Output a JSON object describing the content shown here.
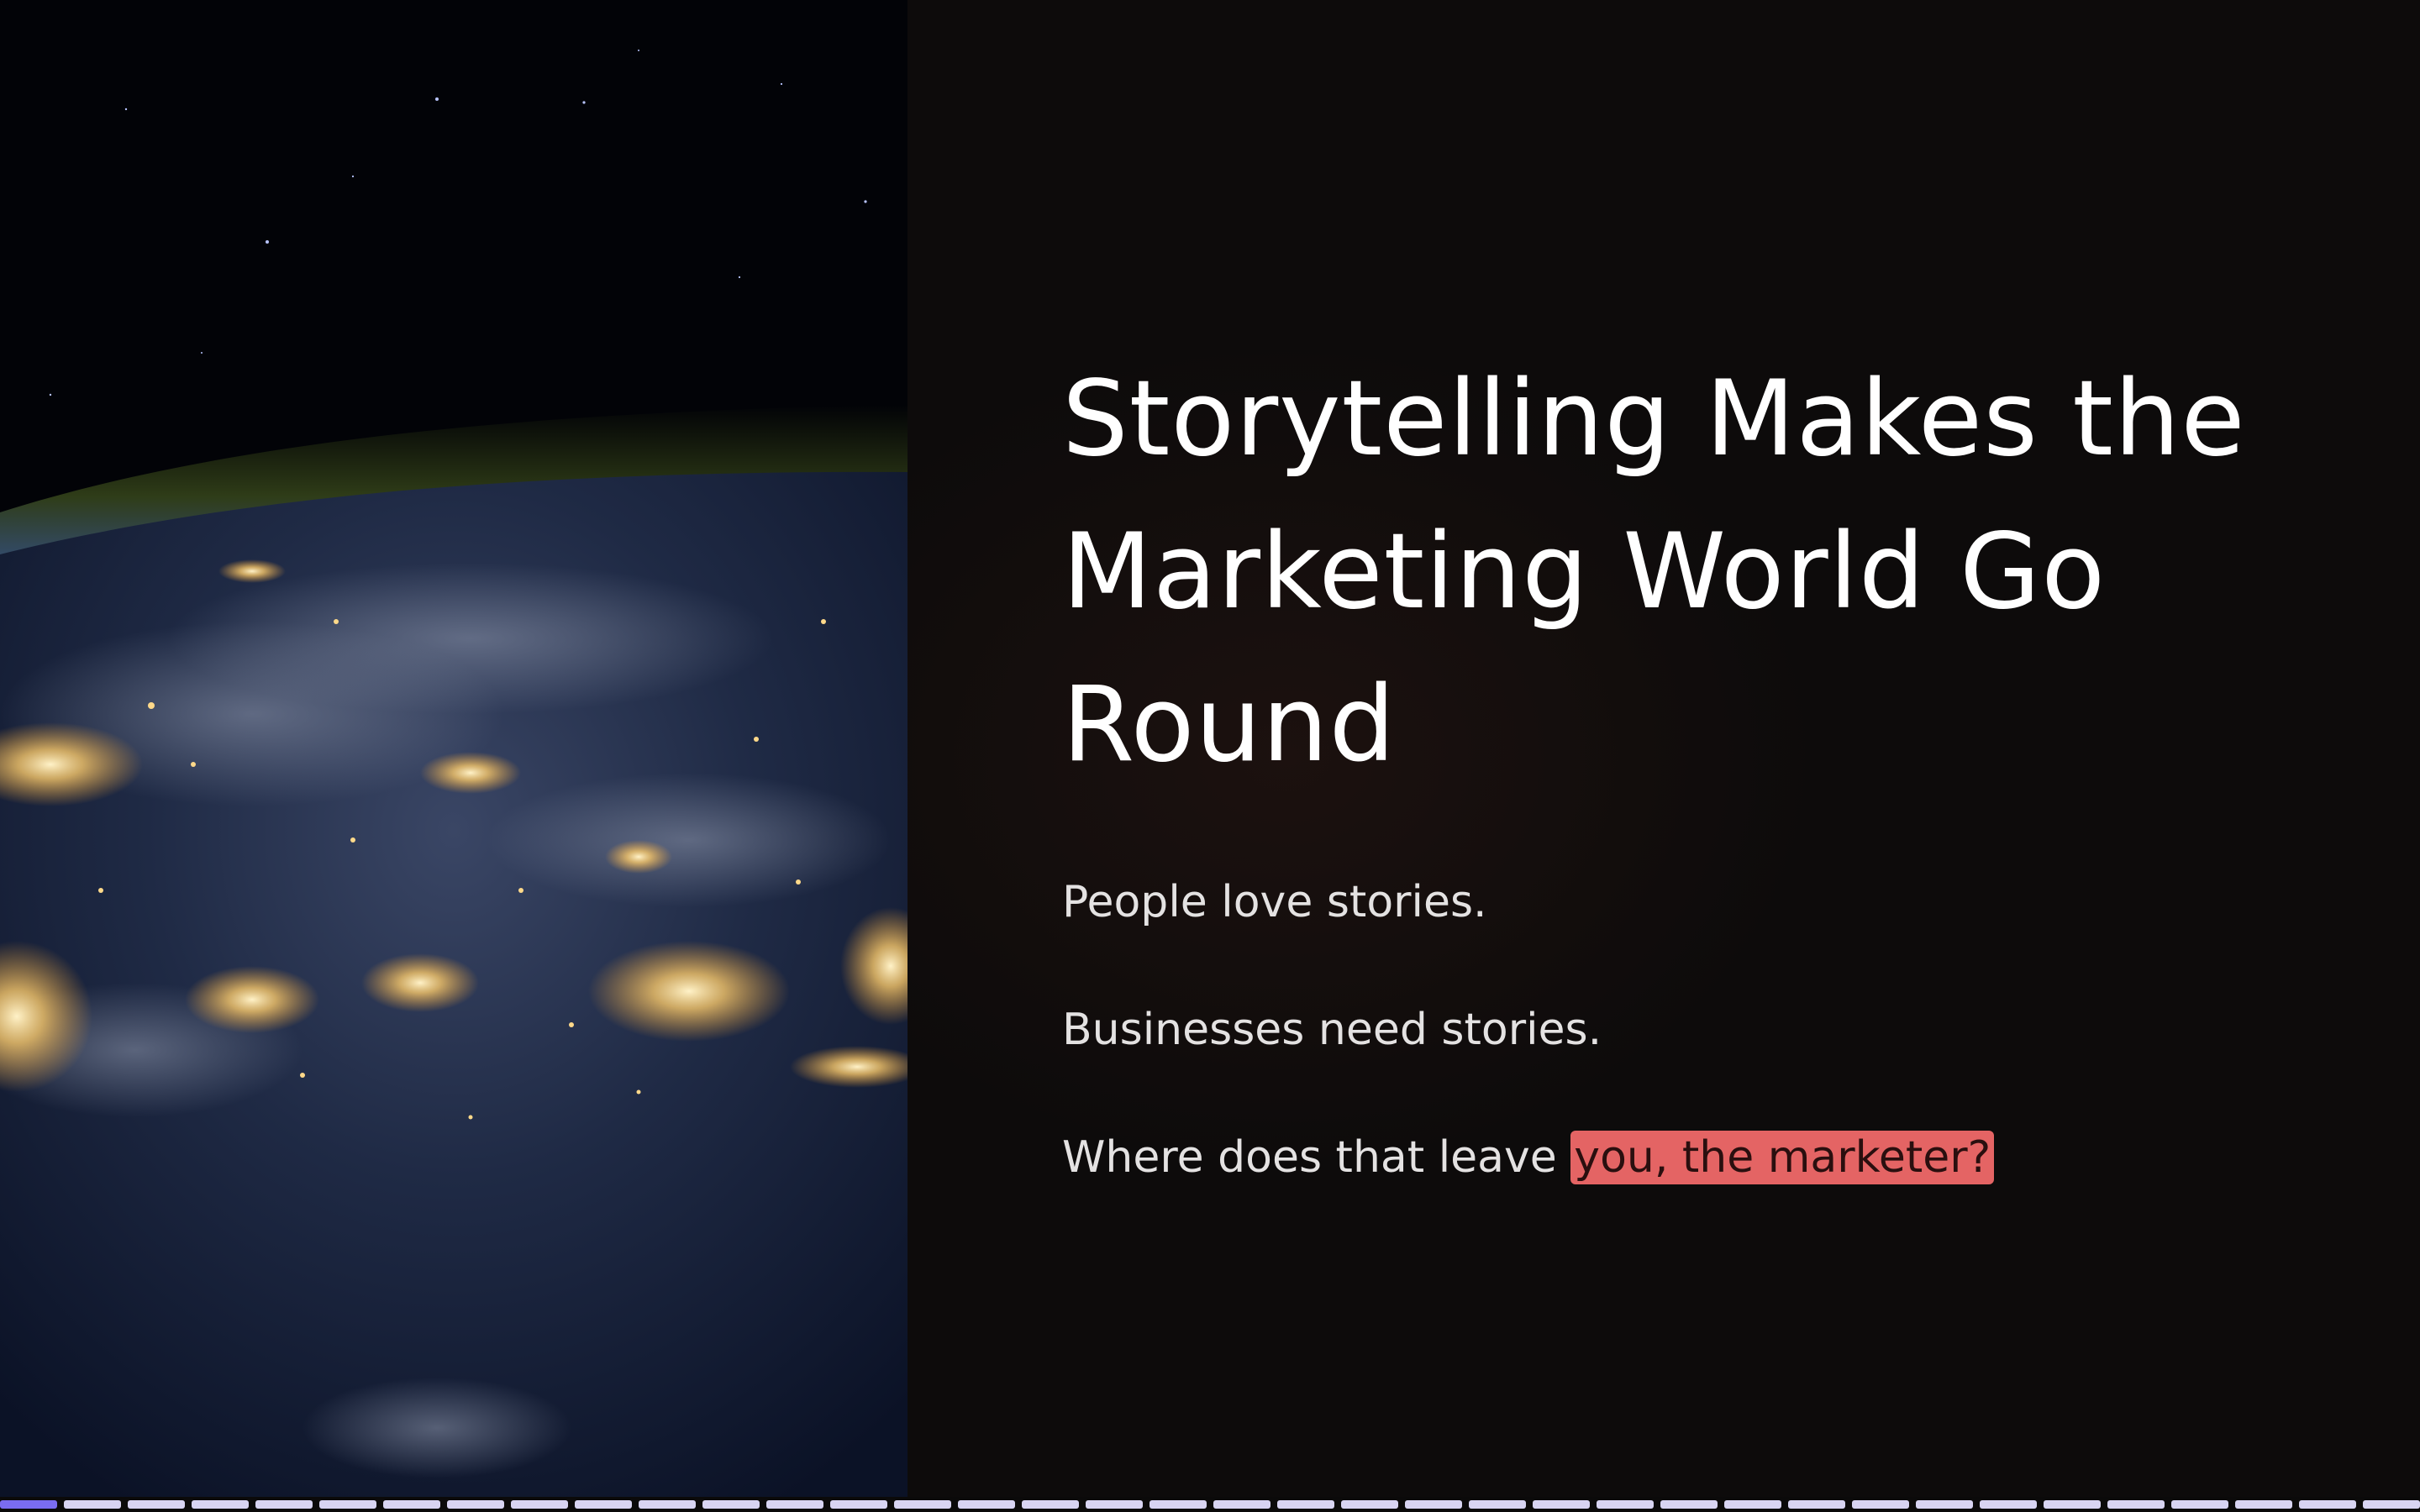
{
  "slide": {
    "title": "Storytelling Makes the Marketing World Go Round",
    "paragraphs": {
      "p1": "People love stories.",
      "p2": "Businesses need stories.",
      "p3_prefix": "Where does that leave ",
      "p3_highlight": "you, the marketer?"
    },
    "image_subject": "earth-at-night-from-space",
    "colors": {
      "background": "#0d0b0b",
      "title_text": "#ffffff",
      "body_text": "#e4e2e2",
      "highlight": "#e46464",
      "progress_active": "#7a6cf0",
      "progress_inactive": "#d8d4f2"
    }
  },
  "progress": {
    "total_segments": 38,
    "current_segment": 1
  }
}
